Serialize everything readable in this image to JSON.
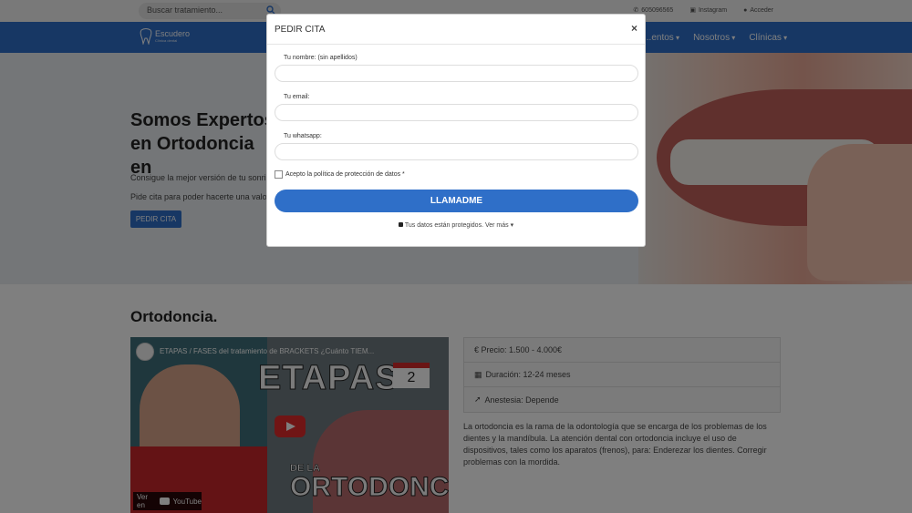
{
  "topbar": {
    "search_placeholder": "Buscar tratamiento...",
    "phone": "605096565",
    "instagram": "Instagram",
    "access": "Acceder"
  },
  "navbar": {
    "logo_name": "Escudero",
    "logo_sub": "Clínica dental",
    "items": [
      "...entos",
      "Nosotros",
      "Clínicas"
    ]
  },
  "hero": {
    "title": "Somos Expertos en Ortodoncia en",
    "p1": "Consigue la mejor versión de tu sonris",
    "p2": "Pide cita para poder hacerte una valor",
    "cta": "PEDIR CITA"
  },
  "section": {
    "title": "Ortodoncia.",
    "video_title": "ETAPAS / FASES del tratamiento de BRACKETS ¿Cuánto TIEM...",
    "video_overlay_top": "ETAPAS",
    "video_overlay_dela": "DE LA",
    "video_overlay_bottom": "ORTODONCIA",
    "calendar_num": "2",
    "watch_on": "Ver en",
    "youtube": "YouTube",
    "price": "€ Precio: 1.500 - 4.000€",
    "duration": "Duración: 12-24 meses",
    "anesthesia": "Anestesia: Depende",
    "description": "La ortodoncia es la rama de la odontología que se encarga de los problemas de los dientes y la mandíbula. La atención dental con ortodoncia incluye el uso de dispositivos, tales como los aparatos (frenos), para: Enderezar los dientes. Corregir problemas con la mordida."
  },
  "modal": {
    "title": "PEDIR CITA",
    "close": "×",
    "name_label": "Tu nombre: (sin apellidos)",
    "email_label": "Tu email:",
    "whatsapp_label": "Tu whatsapp:",
    "checkbox_label": "Acepto la política de protección de datos *",
    "button": "LLAMADME",
    "privacy": "Tus datos están protegidos. Ver más ▾"
  }
}
